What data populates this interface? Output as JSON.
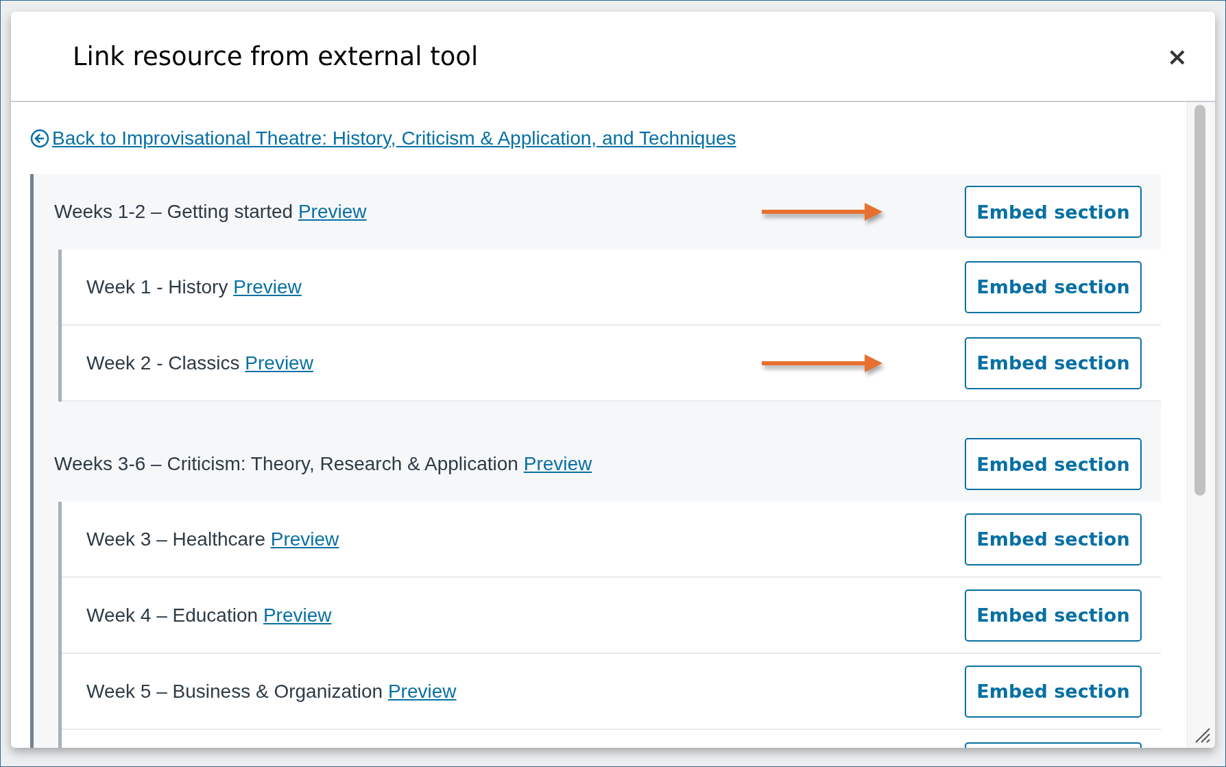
{
  "dialog": {
    "title": "Link resource from external tool",
    "close": "×"
  },
  "back_link": "Back to Improvisational Theatre: History, Criticism & Application, and Techniques",
  "groups": [
    {
      "title": "Weeks 1-2 – Getting started",
      "preview": "Preview",
      "button": "Embed section",
      "arrow": true,
      "children": [
        {
          "kind": "row",
          "title": "Week 1 - History",
          "preview": "Preview",
          "button": "Embed section",
          "arrow": false
        },
        {
          "kind": "row",
          "title": "Week 2 - Classics",
          "preview": "Preview",
          "button": "Embed section",
          "arrow": true
        }
      ]
    },
    {
      "title": "Weeks 3-6 – Criticism: Theory, Research & Application",
      "preview": "Preview",
      "button": "Embed section",
      "arrow": false,
      "children": [
        {
          "kind": "row",
          "title": "Week 3 – Healthcare",
          "preview": "Preview",
          "button": "Embed section",
          "arrow": false
        },
        {
          "kind": "row",
          "title": "Week 4 – Education",
          "preview": "Preview",
          "button": "Embed section",
          "arrow": false
        },
        {
          "kind": "row",
          "title": "Week 5 – Business & Organization",
          "preview": "Preview",
          "button": "Embed section",
          "arrow": false
        },
        {
          "kind": "cut"
        }
      ]
    }
  ]
}
